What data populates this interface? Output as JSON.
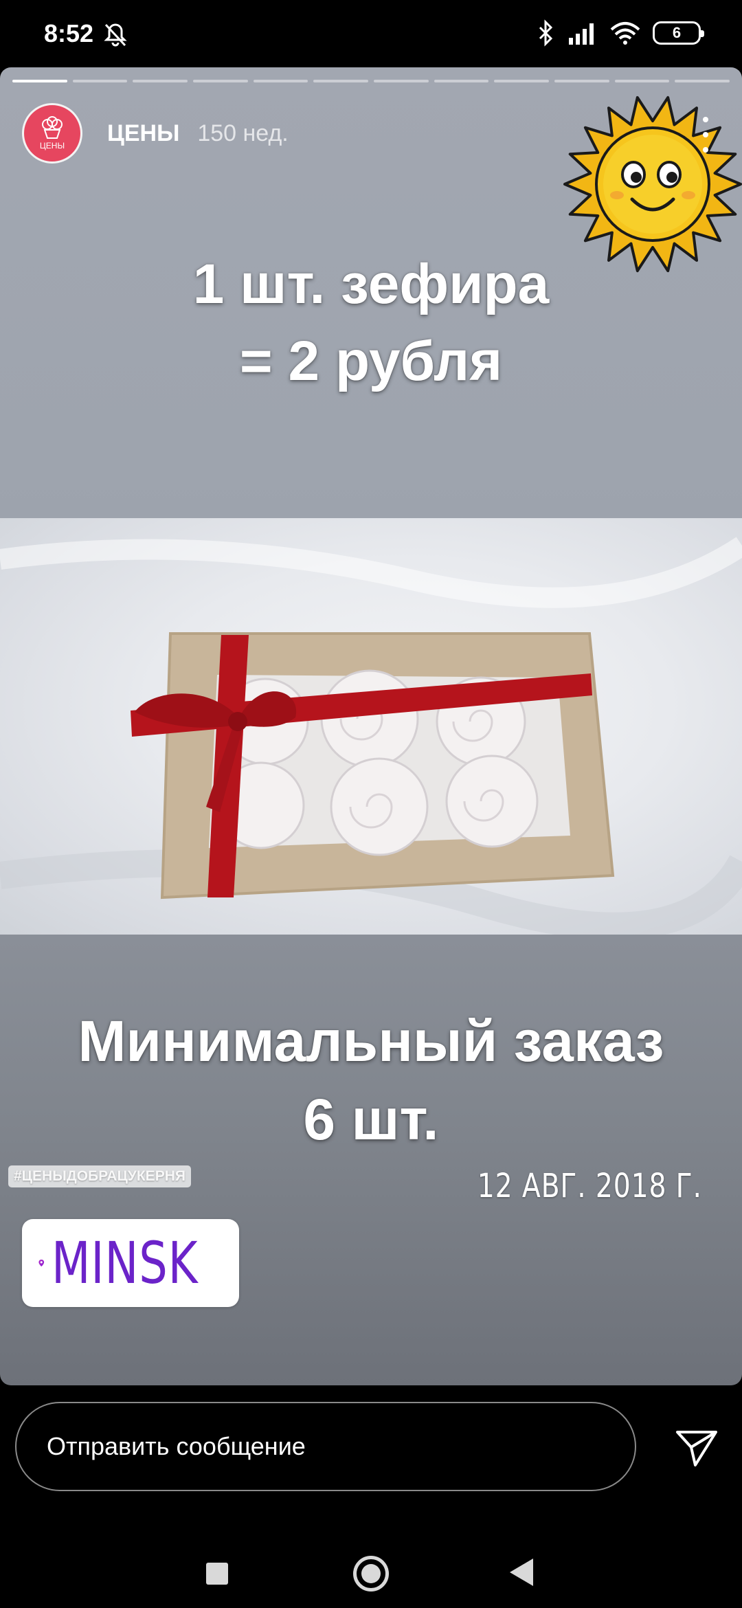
{
  "status_bar": {
    "time": "8:52",
    "battery_level": "6",
    "icons": [
      "notifications-off-icon",
      "bluetooth-icon",
      "signal-icon",
      "wifi-icon",
      "battery-icon"
    ]
  },
  "story": {
    "progress": {
      "total_segments": 12,
      "current_segment": 1
    },
    "account": {
      "name": "ЦЕНЫ",
      "age": "150 нед.",
      "avatar_text": "ЦЕНЫ",
      "avatar_color": "#e6465f"
    },
    "headline_top": {
      "line1": "1 шт. зефира",
      "line2": "= 2 рубля"
    },
    "headline_bottom": {
      "line1": "Минимальный заказ",
      "line2": "6 шт."
    },
    "hashtag": "#ЦЕНЫДОБРАЦУКЕРНЯ",
    "date": "12 АВГ. 2018 Г.",
    "location": "MINSK",
    "sticker": "sun-sticker",
    "photo": "marshmallow-gift-box-photo"
  },
  "reply": {
    "placeholder": "Отправить сообщение"
  },
  "colors": {
    "accent": "#e6465f",
    "location_text": "#6b23c9",
    "ribbon": "#b5141c",
    "box": "#c8b59a"
  }
}
